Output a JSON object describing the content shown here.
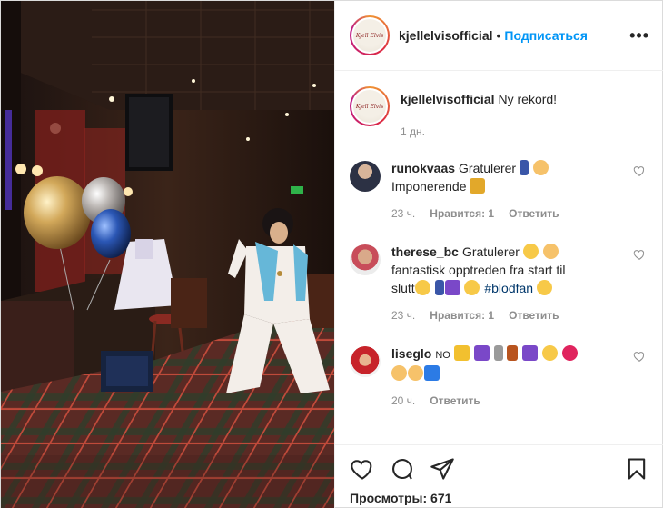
{
  "post": {
    "username": "kjellelvisofficial",
    "separator": "•",
    "follow_label": "Подписаться",
    "more_label": "•••",
    "avatar_text": "Kjell Elvis"
  },
  "caption": {
    "username": "kjellelvisofficial",
    "text": "Ny rekord!",
    "time": "1 дн."
  },
  "comments": [
    {
      "username": "runokvaas",
      "text_before": "Gratulerer",
      "emojis_line1": [
        "runner",
        "clap"
      ],
      "text_line2": "Imponerende",
      "emojis_line2": [
        "trophy"
      ],
      "time": "23 ч.",
      "likes": "Нравится: 1",
      "reply": "Ответить"
    },
    {
      "username": "therese_bc",
      "text_before": "Gratulerer",
      "text_line2": "fantastisk opptreden fra start til",
      "text_line3": "slutt",
      "hashtag": "#blodfan",
      "time": "23 ч.",
      "likes": "Нравится: 1",
      "reply": "Ответить"
    },
    {
      "username": "liseglo",
      "ng_badge": "NO",
      "time": "20 ч.",
      "reply": "Ответить"
    }
  ],
  "actions": {
    "like_icon": "heart-icon",
    "comment_icon": "comment-icon",
    "share_icon": "paper-plane-icon",
    "save_icon": "bookmark-icon",
    "views": "Просмотры: 671"
  }
}
